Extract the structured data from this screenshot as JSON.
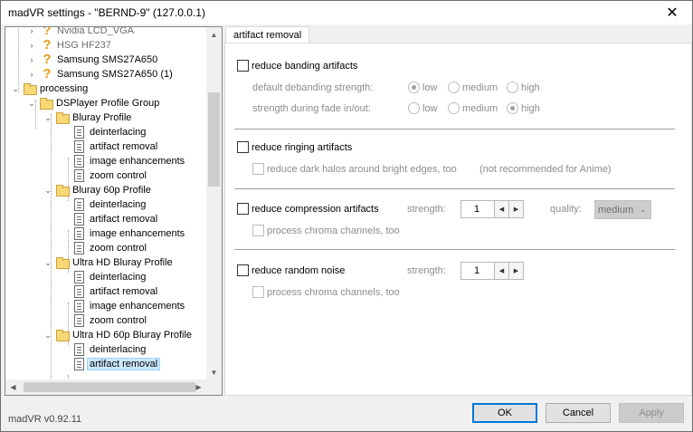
{
  "window": {
    "title": "madVR settings - \"BERND-9\" (127.0.0.1)",
    "close_glyph": "✕"
  },
  "tree": {
    "items": [
      {
        "label": "Nvidia LCD_VGA",
        "icon": "question-icon",
        "gray": true
      },
      {
        "label": "HSG HF237",
        "icon": "question-icon",
        "gray": true
      },
      {
        "label": "Samsung SMS27A650",
        "icon": "question-icon"
      },
      {
        "label": "Samsung SMS27A650 (1)",
        "icon": "question-icon"
      },
      {
        "label": "processing",
        "icon": "folder-icon"
      },
      {
        "label": "DSPlayer Profile Group",
        "icon": "folder-icon"
      },
      {
        "label": "Bluray Profile",
        "icon": "folder-icon"
      },
      {
        "label": "deinterlacing",
        "icon": "page-icon"
      },
      {
        "label": "artifact removal",
        "icon": "page-icon"
      },
      {
        "label": "image enhancements",
        "icon": "page-icon"
      },
      {
        "label": "zoom control",
        "icon": "page-icon"
      },
      {
        "label": "Bluray 60p Profile",
        "icon": "folder-icon"
      },
      {
        "label": "deinterlacing",
        "icon": "page-icon"
      },
      {
        "label": "artifact removal",
        "icon": "page-icon"
      },
      {
        "label": "image enhancements",
        "icon": "page-icon"
      },
      {
        "label": "zoom control",
        "icon": "page-icon"
      },
      {
        "label": "Ultra HD Bluray Profile",
        "icon": "folder-icon"
      },
      {
        "label": "deinterlacing",
        "icon": "page-icon"
      },
      {
        "label": "artifact removal",
        "icon": "page-icon"
      },
      {
        "label": "image enhancements",
        "icon": "page-icon"
      },
      {
        "label": "zoom control",
        "icon": "page-icon"
      },
      {
        "label": "Ultra HD 60p Bluray Profile",
        "icon": "folder-icon"
      },
      {
        "label": "deinterlacing",
        "icon": "page-icon"
      },
      {
        "label": "artifact removal",
        "icon": "page-icon",
        "selected": true
      }
    ]
  },
  "tab": {
    "label": "artifact removal"
  },
  "banding": {
    "checkbox": "reduce banding artifacts",
    "default_label": "default debanding strength:",
    "fade_label": "strength during fade in/out:",
    "opt_low": "low",
    "opt_medium": "medium",
    "opt_high": "high",
    "default_selected": "low",
    "fade_selected": "high"
  },
  "ringing": {
    "checkbox": "reduce ringing artifacts",
    "halos": "reduce dark halos around bright edges, too",
    "note": "(not recommended for Anime)"
  },
  "compression": {
    "checkbox": "reduce compression artifacts",
    "strength_label": "strength:",
    "strength_value": "1",
    "quality_label": "quality:",
    "quality_value": "medium",
    "chroma": "process chroma channels, too"
  },
  "noise": {
    "checkbox": "reduce random noise",
    "strength_label": "strength:",
    "strength_value": "1",
    "chroma": "process chroma channels, too"
  },
  "footer": {
    "version": "madVR v0.92.11",
    "ok": "OK",
    "cancel": "Cancel",
    "apply": "Apply"
  },
  "glyphs": {
    "left": "◀",
    "right": "▶",
    "up": "▲",
    "down": "▼",
    "expanded": "⌄",
    "collapsed": "›",
    "dropdown": "⌄"
  }
}
